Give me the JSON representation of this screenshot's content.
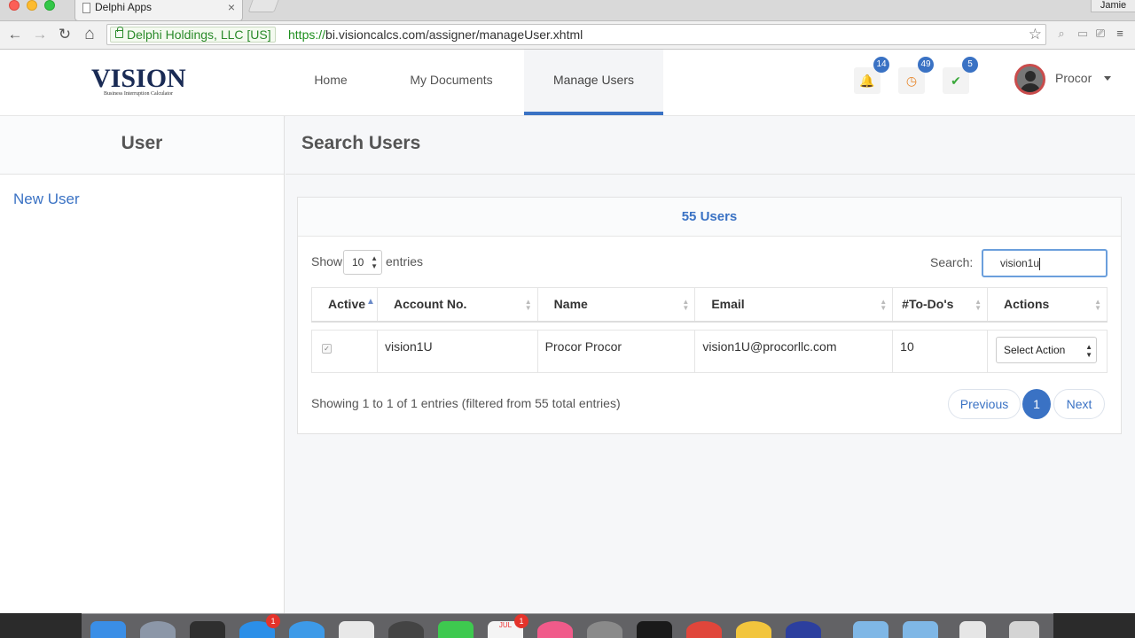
{
  "browser": {
    "tab_title": "Delphi Apps",
    "tab_close": "×",
    "profile_name": "Jamie",
    "back": "←",
    "forward": "→",
    "reload": "↻",
    "home": "⌂",
    "ev_label": "Delphi Holdings, LLC [US]",
    "url_scheme": "https://",
    "url_rest": "bi.visioncalcs.com/assigner/manageUser.xhtml",
    "star": "☆"
  },
  "header": {
    "logo_text": "VISION",
    "logo_subtitle": "Business Interruption Calculator",
    "menu": [
      {
        "label": "Home"
      },
      {
        "label": "My Documents"
      },
      {
        "label": "Manage Users",
        "active": true
      }
    ],
    "notifications": [
      {
        "icon": "bell-icon",
        "glyph": "🔔",
        "count": "14",
        "color": "#e0413b"
      },
      {
        "icon": "clock-icon",
        "glyph": "◷",
        "count": "49",
        "color": "#e8862a"
      },
      {
        "icon": "check-icon",
        "glyph": "✔",
        "count": "5",
        "color": "#3aa83a"
      }
    ],
    "user_name": "Procor"
  },
  "sidebar": {
    "title": "User",
    "links": [
      {
        "label": "New User"
      }
    ]
  },
  "main": {
    "title": "Search Users",
    "panel_title": "55 Users",
    "show_label": "Show",
    "page_size": "10",
    "entries_label": "entries",
    "search_label": "Search:",
    "search_value": "vision1u",
    "columns": [
      "Active",
      "Account No.",
      "Name",
      "Email",
      "#To-Do's",
      "Actions"
    ],
    "rows": [
      {
        "active": true,
        "account": "vision1U",
        "name": "Procor Procor",
        "email": "vision1U@procorllc.com",
        "todos": "10",
        "action": "Select Action"
      }
    ],
    "info": "Showing 1 to 1 of 1 entries (filtered from 55 total entries)",
    "pager": {
      "previous": "Previous",
      "current": "1",
      "next": "Next"
    }
  },
  "dock": {
    "badges": {
      "appstore": "1",
      "calendar": "1"
    },
    "calendar_month": "JUL"
  }
}
